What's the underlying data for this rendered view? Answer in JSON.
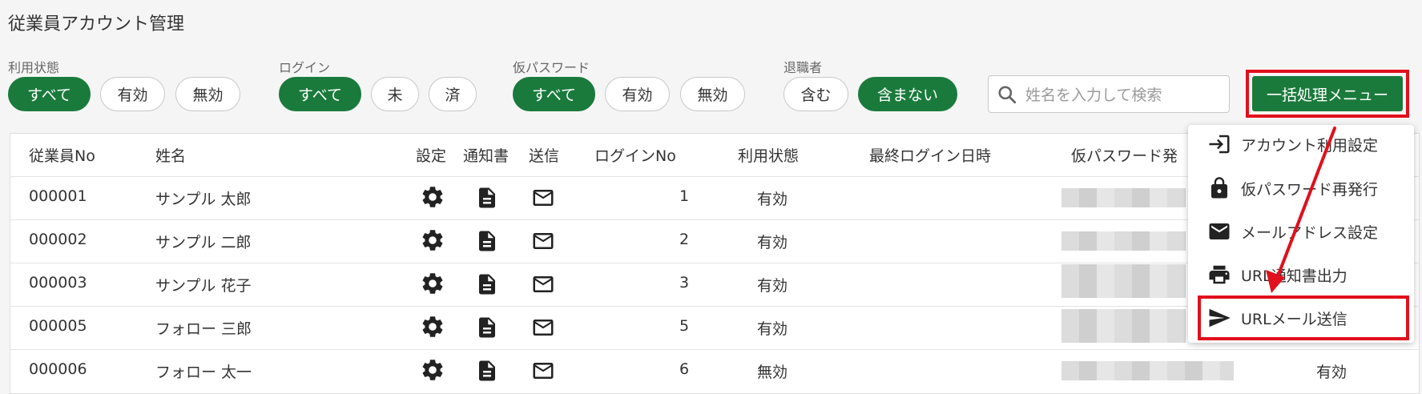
{
  "page": {
    "title": "従業員アカウント管理"
  },
  "filters": {
    "usage": {
      "label": "利用状態",
      "options": [
        "すべて",
        "有効",
        "無効"
      ],
      "selected": "すべて"
    },
    "login": {
      "label": "ログイン",
      "options": [
        "すべて",
        "未",
        "済"
      ],
      "selected": "すべて"
    },
    "temp_password": {
      "label": "仮パスワード",
      "options": [
        "すべて",
        "有効",
        "無効"
      ],
      "selected": "すべて"
    },
    "retired": {
      "label": "退職者",
      "options": [
        "含む",
        "含まない"
      ],
      "selected": "含まない"
    }
  },
  "search": {
    "placeholder": "姓名を入力して検索",
    "value": ""
  },
  "bulk_menu": {
    "button_label": "一括処理メニュー",
    "items": [
      {
        "label": "アカウント利用設定",
        "icon": "login-icon"
      },
      {
        "label": "仮パスワード再発行",
        "icon": "lock-icon"
      },
      {
        "label": "メールアドレス設定",
        "icon": "mail-icon"
      },
      {
        "label": "URL通知書出力",
        "icon": "printer-icon"
      },
      {
        "label": "URLメール送信",
        "icon": "send-icon",
        "highlighted": true
      }
    ]
  },
  "table": {
    "headers": [
      "従業員No",
      "姓名",
      "設定",
      "通知書",
      "送信",
      "ログインNo",
      "利用状態",
      "最終ログイン日時",
      "仮パスワード発"
    ],
    "rows": [
      {
        "no": "000001",
        "name": "サンプル 太郎",
        "login_no": "1",
        "status": "有効"
      },
      {
        "no": "000002",
        "name": "サンプル 二郎",
        "login_no": "2",
        "status": "有効"
      },
      {
        "no": "000003",
        "name": "サンプル 花子",
        "login_no": "3",
        "status": "有効"
      },
      {
        "no": "000005",
        "name": "フォロー 三郎",
        "login_no": "5",
        "status": "有効"
      },
      {
        "no": "000006",
        "name": "フォロー 太一",
        "login_no": "6",
        "status": "無効",
        "extra_status": "有効"
      }
    ]
  },
  "colors": {
    "accent": "#1a7a3c",
    "highlight": "#e0101c"
  }
}
